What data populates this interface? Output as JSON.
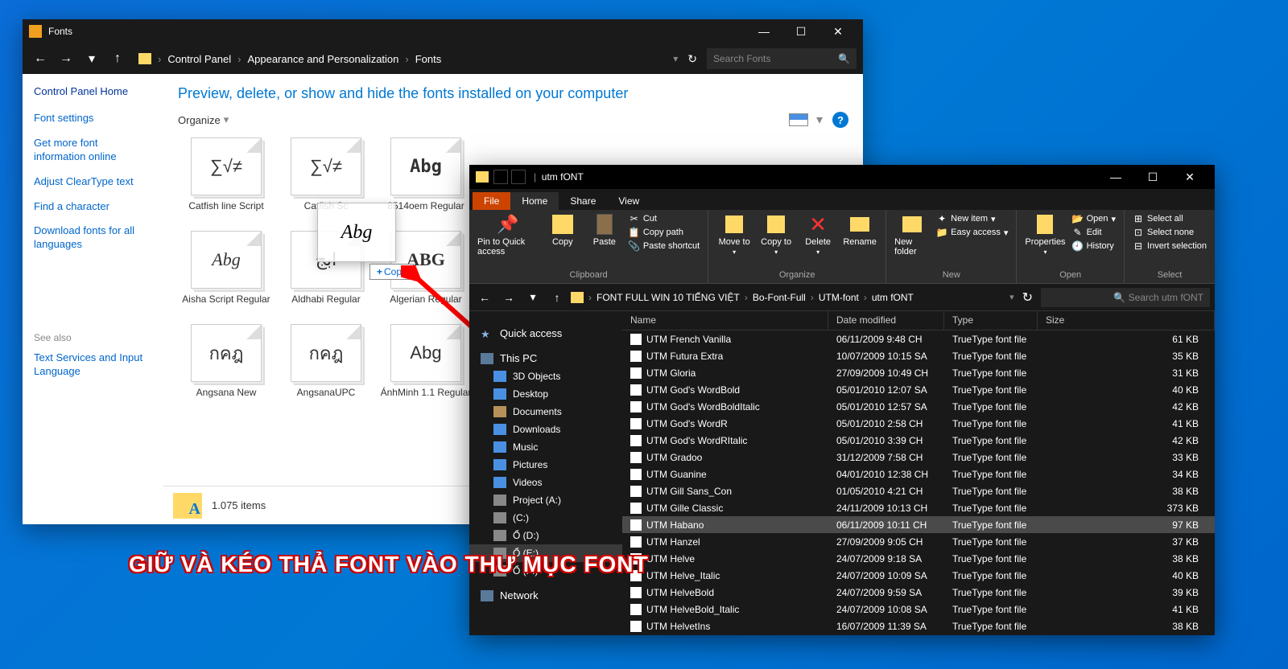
{
  "cp": {
    "title": "Fonts",
    "breadcrumb": [
      "Control Panel",
      "Appearance and Personalization",
      "Fonts"
    ],
    "search_placeholder": "Search Fonts",
    "sidebar": {
      "home": "Control Panel Home",
      "links": [
        "Font settings",
        "Get more font information online",
        "Adjust ClearType text",
        "Find a character",
        "Download fonts for all languages"
      ],
      "seealso_h": "See also",
      "seealso": "Text Services and Input Language"
    },
    "heading": "Preview, delete, or show and hide the fonts installed on your computer",
    "organize": "Organize",
    "fonts": [
      {
        "preview": "∑√≠",
        "label": "Catfish line Script"
      },
      {
        "preview": "∑√≠",
        "label": "Catfish Sc"
      },
      {
        "preview": "Abg",
        "label": "8514oem Regular",
        "pix": true
      },
      {
        "preview": "Abg",
        "label": "Aisha Script Regular",
        "script": true
      },
      {
        "preview": "ابج",
        "label": "Aldhabi Regular"
      },
      {
        "preview": "ABG",
        "label": "Algerian Regular",
        "serif": true
      },
      {
        "preview": "กคฎ",
        "label": "Angsana New"
      },
      {
        "preview": "กคฎ",
        "label": "AngsanaUPC"
      },
      {
        "preview": "Abg",
        "label": "ÁnhMinh 1.1 Regular"
      }
    ],
    "status_count": "1.075 items",
    "drag_preview": "Abg",
    "copy_badge": "Copy"
  },
  "ex": {
    "title": "utm fONT",
    "tabs": [
      "File",
      "Home",
      "Share",
      "View"
    ],
    "ribbon": {
      "pin": "Pin to Quick access",
      "copy": "Copy",
      "paste": "Paste",
      "cut": "Cut",
      "copypath": "Copy path",
      "pasteshortcut": "Paste shortcut",
      "moveto": "Move to",
      "copyto": "Copy to",
      "delete": "Delete",
      "rename": "Rename",
      "newfolder": "New folder",
      "newitem": "New item",
      "easyaccess": "Easy access",
      "properties": "Properties",
      "open": "Open",
      "edit": "Edit",
      "history": "History",
      "selectall": "Select all",
      "selectnone": "Select none",
      "invertsel": "Invert selection",
      "groups": {
        "clipboard": "Clipboard",
        "organize": "Organize",
        "new": "New",
        "open": "Open",
        "select": "Select"
      }
    },
    "path": [
      "FONT FULL WIN 10 TIẾNG VIỆT",
      "Bo-Font-Full",
      "UTM-font",
      "utm fONT"
    ],
    "search_placeholder": "Search utm fONT",
    "nav": {
      "quick": "Quick access",
      "thispc": "This PC",
      "3d": "3D Objects",
      "desktop": "Desktop",
      "documents": "Documents",
      "downloads": "Downloads",
      "music": "Music",
      "pictures": "Pictures",
      "videos": "Videos",
      "projecta": "Project (A:)",
      "drivec": "(C:)",
      "drived": "Ổ (D:)",
      "drivee": "Ổ (E:)",
      "drivef": "Ổ (F:)",
      "network": "Network"
    },
    "cols": {
      "name": "Name",
      "date": "Date modified",
      "type": "Type",
      "size": "Size"
    },
    "rows": [
      {
        "n": "UTM French Vanilla",
        "d": "06/11/2009 9:48 CH",
        "t": "TrueType font file",
        "s": "61 KB"
      },
      {
        "n": "UTM Futura Extra",
        "d": "10/07/2009 10:15 SA",
        "t": "TrueType font file",
        "s": "35 KB"
      },
      {
        "n": "UTM Gloria",
        "d": "27/09/2009 10:49 CH",
        "t": "TrueType font file",
        "s": "31 KB"
      },
      {
        "n": "UTM God's WordBold",
        "d": "05/01/2010 12:07 SA",
        "t": "TrueType font file",
        "s": "40 KB"
      },
      {
        "n": "UTM God's WordBoldItalic",
        "d": "05/01/2010 12:57 SA",
        "t": "TrueType font file",
        "s": "42 KB"
      },
      {
        "n": "UTM God's WordR",
        "d": "05/01/2010 2:58 CH",
        "t": "TrueType font file",
        "s": "41 KB"
      },
      {
        "n": "UTM God's WordRItalic",
        "d": "05/01/2010 3:39 CH",
        "t": "TrueType font file",
        "s": "42 KB"
      },
      {
        "n": "UTM Gradoo",
        "d": "31/12/2009 7:58 CH",
        "t": "TrueType font file",
        "s": "33 KB"
      },
      {
        "n": "UTM Guanine",
        "d": "04/01/2010 12:38 CH",
        "t": "TrueType font file",
        "s": "34 KB"
      },
      {
        "n": "UTM Gill Sans_Con",
        "d": "01/05/2010 4:21 CH",
        "t": "TrueType font file",
        "s": "38 KB"
      },
      {
        "n": "UTM Gille Classic",
        "d": "24/11/2009 10:13 CH",
        "t": "TrueType font file",
        "s": "373 KB"
      },
      {
        "n": "UTM Habano",
        "d": "06/11/2009 10:11 CH",
        "t": "TrueType font file",
        "s": "97 KB",
        "sel": true
      },
      {
        "n": "UTM Hanzel",
        "d": "27/09/2009 9:05 CH",
        "t": "TrueType font file",
        "s": "37 KB"
      },
      {
        "n": "UTM Helve",
        "d": "24/07/2009 9:18 SA",
        "t": "TrueType font file",
        "s": "38 KB"
      },
      {
        "n": "UTM Helve_Italic",
        "d": "24/07/2009 10:09 SA",
        "t": "TrueType font file",
        "s": "40 KB"
      },
      {
        "n": "UTM HelveBold",
        "d": "24/07/2009 9:59 SA",
        "t": "TrueType font file",
        "s": "39 KB"
      },
      {
        "n": "UTM HelveBold_Italic",
        "d": "24/07/2009 10:08 SA",
        "t": "TrueType font file",
        "s": "41 KB"
      },
      {
        "n": "UTM HelvetIns",
        "d": "16/07/2009 11:39 SA",
        "t": "TrueType font file",
        "s": "38 KB"
      }
    ]
  },
  "caption": "GIỮ VÀ KÉO THẢ FONT VÀO THƯ MỤC FONT"
}
